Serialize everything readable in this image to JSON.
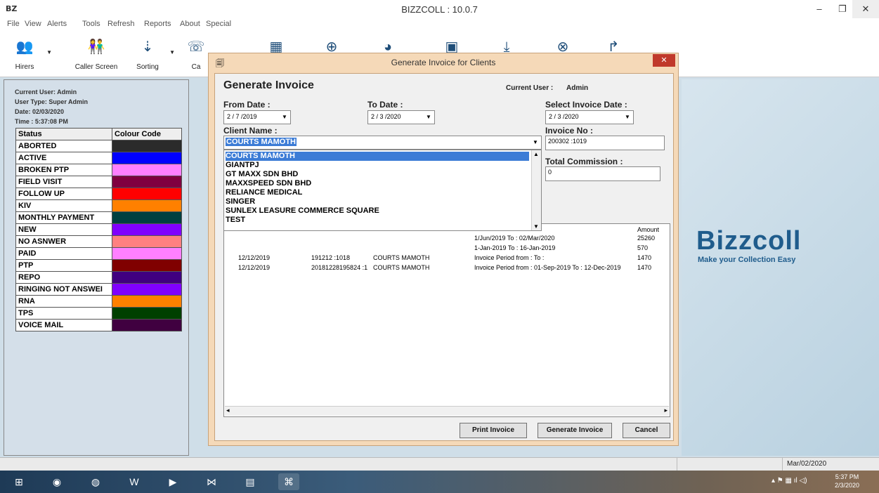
{
  "app": {
    "icon": "BZ",
    "title": "BIZZCOLL : 10.0.7",
    "min": "–",
    "max": "❐",
    "close": "✕"
  },
  "menu": [
    "File",
    "View",
    "Alerts",
    "Tools",
    "Refresh",
    "Reports",
    "About",
    "Special"
  ],
  "toolbar": {
    "hirers": "Hirers",
    "caller_screen": "Caller Screen",
    "sorting": "Sorting",
    "ca": "Ca"
  },
  "user_info": {
    "current_user": "Current User: Admin",
    "user_type": "User Type: Super Admin",
    "date": "Date: 02/03/2020",
    "time": "Time : 5:37:08 PM"
  },
  "status_table": {
    "col1": "Status",
    "col2": "Colour Code",
    "rows": [
      {
        "label": "ABORTED",
        "color": "#2b2b2b"
      },
      {
        "label": "ACTIVE",
        "color": "#0000ff"
      },
      {
        "label": "BROKEN PTP",
        "color": "#ff80ff"
      },
      {
        "label": "FIELD VISIT",
        "color": "#800040"
      },
      {
        "label": "FOLLOW UP",
        "color": "#ff0000"
      },
      {
        "label": "KIV",
        "color": "#ff8000"
      },
      {
        "label": "MONTHLY PAYMENT",
        "color": "#004040"
      },
      {
        "label": "NEW",
        "color": "#8000ff"
      },
      {
        "label": "NO ASNWER",
        "color": "#ff8080"
      },
      {
        "label": "PAID",
        "color": "#ff80ff"
      },
      {
        "label": "PTP",
        "color": "#800000"
      },
      {
        "label": "REPO",
        "color": "#400080"
      },
      {
        "label": "RINGING NOT ANSWEI",
        "color": "#8000ff"
      },
      {
        "label": "RNA",
        "color": "#ff8000"
      },
      {
        "label": "TPS",
        "color": "#004000"
      },
      {
        "label": "VOICE MAIL",
        "color": "#400040"
      }
    ]
  },
  "brand": {
    "name": "Bizzcoll",
    "tagline": "Make your Collection Easy"
  },
  "dialog": {
    "title": "Generate Invoice for Clients",
    "close": "✕",
    "heading": "Generate Invoice",
    "current_user_label": "Current User :",
    "current_user": "Admin",
    "from_date_label": "From Date :",
    "from_date": "2 / 7 /2019",
    "to_date_label": "To Date :",
    "to_date": "2 / 3 /2020",
    "invoice_date_label": "Select Invoice Date :",
    "invoice_date": "2 / 3 /2020",
    "client_label": "Client Name :",
    "client_value": "COURTS MAMOTH",
    "invoice_no_label": "Invoice No :",
    "invoice_no": "200302 :1019",
    "total_commission_label": "Total Commission :",
    "total_commission": "0",
    "clients": [
      "COURTS MAMOTH",
      "GIANTPJ",
      "GT MAXX SDN BHD",
      "MAXXSPEED SDN BHD",
      "RELIANCE MEDICAL",
      "SINGER",
      "SUNLEX LEASURE COMMERCE SQUARE",
      "TEST"
    ],
    "grid_header_amount": "Amount",
    "grid_rows": [
      {
        "date": "",
        "invno": "",
        "client": "",
        "period": "1/Jun/2019 To : 02/Mar/2020",
        "amount": "25260"
      },
      {
        "date": "",
        "invno": "",
        "client": "",
        "period": "1-Jan-2019 To : 16-Jan-2019",
        "amount": "570"
      },
      {
        "date": "12/12/2019",
        "invno": "191212 :1018",
        "client": "COURTS MAMOTH",
        "period": "Invoice Period from : To :",
        "amount": "1470"
      },
      {
        "date": "12/12/2019",
        "invno": "20181228195824 :1",
        "client": "COURTS MAMOTH",
        "period": "Invoice Period from : 01-Sep-2019 To : 12-Dec-2019",
        "amount": "1470"
      }
    ],
    "print_button": "Print Invoice",
    "generate_button": "Generate Invoice",
    "cancel_button": "Cancel"
  },
  "statusbar": {
    "date": "Mar/02/2020"
  },
  "taskbar": {
    "time": "5:37 PM",
    "date": "2/3/2020"
  }
}
